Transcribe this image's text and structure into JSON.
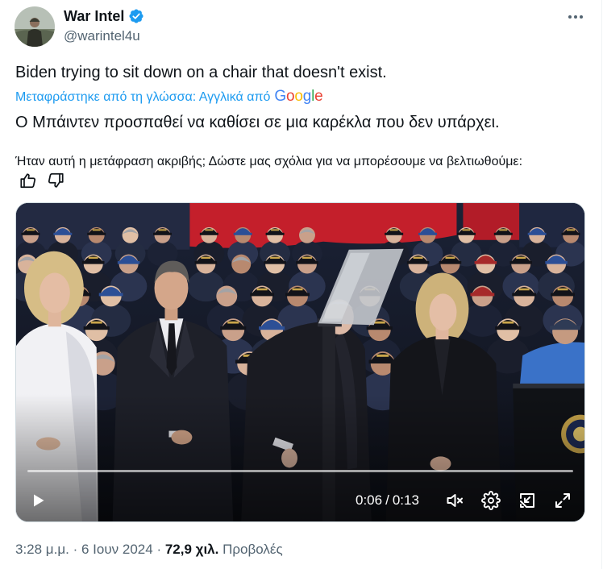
{
  "author": {
    "name": "War Intel",
    "handle": "@warintel4u",
    "verified": true,
    "badge_icon": "verified-badge-icon"
  },
  "header": {
    "more_icon": "more-horizontal-icon"
  },
  "tweet": {
    "text": "Biden trying to sit down on a chair that doesn't exist.",
    "translation": {
      "label": "Μεταφράστηκε από τη γλώσσα: Αγγλικά από",
      "provider": "Google",
      "text": "Ο Μπάιντεν προσπαθεί να καθίσει σε μια καρέκλα που δεν υπάρχει.",
      "feedback_question": "Ήταν αυτή η μετάφραση ακριβής; Δώστε μας σχόλια για να μπορέσουμε να βελτιωθούμε:",
      "feedback_icons": [
        "thumbs-up-icon",
        "thumbs-down-icon"
      ]
    }
  },
  "video": {
    "current_time": "0:06",
    "separator": "/",
    "duration": "0:13",
    "control_icons": [
      "play-icon",
      "volume-muted-icon",
      "settings-gear-icon",
      "picture-in-picture-icon",
      "fullscreen-icon"
    ]
  },
  "meta": {
    "time": "3:28 μ.μ.",
    "separator": "·",
    "date": "6 Ιουν 2024",
    "views_count": "72,9 χιλ.",
    "views_label": "Προβολές"
  },
  "colors": {
    "text": "#0f1419",
    "secondary": "#536471",
    "accent": "#1d9bf0",
    "google_letters": [
      "#4285f4",
      "#ea4335",
      "#fbbc05",
      "#4285f4",
      "#34a853",
      "#ea4335"
    ]
  }
}
